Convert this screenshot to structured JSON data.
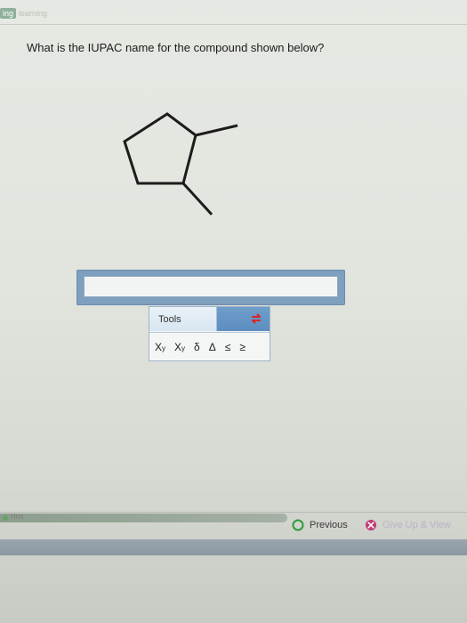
{
  "header": {
    "brand_left": "ing",
    "brand_right": "learning"
  },
  "question": {
    "text": "What is the IUPAC name for the compound shown below?"
  },
  "answer": {
    "value": "",
    "placeholder": ""
  },
  "tools": {
    "label": "Tools",
    "toggle_icon": "swap-arrows-icon",
    "symbols": {
      "subscript_base": "X",
      "subscript_mark": "y",
      "superscript_base": "X",
      "superscript_mark": "y",
      "delta_lower": "δ",
      "delta_upper": "Δ",
      "leq": "≤",
      "geq": "≥"
    }
  },
  "footer": {
    "help_label": "Hint",
    "previous_label": "Previous",
    "giveup_label": "Give Up & View"
  }
}
